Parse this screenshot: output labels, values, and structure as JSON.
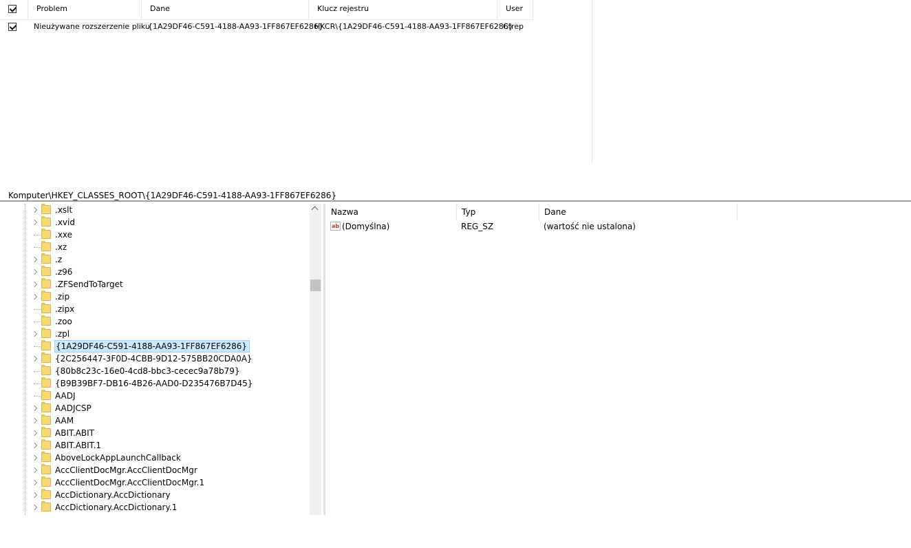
{
  "issues": {
    "columns": [
      "Problem",
      "Dane",
      "Klucz rejestru",
      "User"
    ],
    "rows": [
      {
        "checked": true,
        "problem": "Nieużywane rozszerzenie pliku",
        "data": "{1A29DF46-C591-4188-AA93-1FF867EF6286}",
        "key": "HKCR\\{1A29DF46-C591-4188-AA93-1FF867EF6286}",
        "user": "Ctrep"
      }
    ]
  },
  "address": "Komputer\\HKEY_CLASSES_ROOT\\{1A29DF46-C591-4188-AA93-1FF867EF6286}",
  "tree": {
    "items": [
      {
        "label": ".xslt",
        "expandable": true
      },
      {
        "label": ".xvid",
        "expandable": true
      },
      {
        "label": ".xxe",
        "expandable": false
      },
      {
        "label": ".xz",
        "expandable": false
      },
      {
        "label": ".z",
        "expandable": true
      },
      {
        "label": ".z96",
        "expandable": true
      },
      {
        "label": ".ZFSendToTarget",
        "expandable": true
      },
      {
        "label": ".zip",
        "expandable": true
      },
      {
        "label": ".zipx",
        "expandable": false
      },
      {
        "label": ".zoo",
        "expandable": false
      },
      {
        "label": ".zpl",
        "expandable": true
      },
      {
        "label": "{1A29DF46-C591-4188-AA93-1FF867EF6286}",
        "expandable": false,
        "selected": true
      },
      {
        "label": "{2C256447-3F0D-4CBB-9D12-575BB20CDA0A}",
        "expandable": true
      },
      {
        "label": "{80b8c23c-16e0-4cd8-bbc3-cecec9a78b79}",
        "expandable": false
      },
      {
        "label": "{B9B39BF7-DB16-4B26-AAD0-D235476B7D45}",
        "expandable": false
      },
      {
        "label": "AADJ",
        "expandable": false
      },
      {
        "label": "AADJCSP",
        "expandable": true
      },
      {
        "label": "AAM",
        "expandable": true
      },
      {
        "label": "ABIT.ABIT",
        "expandable": true
      },
      {
        "label": "ABIT.ABIT.1",
        "expandable": true
      },
      {
        "label": "AboveLockAppLaunchCallback",
        "expandable": true
      },
      {
        "label": "AccClientDocMgr.AccClientDocMgr",
        "expandable": true
      },
      {
        "label": "AccClientDocMgr.AccClientDocMgr.1",
        "expandable": true
      },
      {
        "label": "AccDictionary.AccDictionary",
        "expandable": true
      },
      {
        "label": "AccDictionary.AccDictionary.1",
        "expandable": true
      }
    ]
  },
  "values": {
    "columns": [
      "Nazwa",
      "Typ",
      "Dane"
    ],
    "rows": [
      {
        "icon": "string-value-icon",
        "icon_text": "ab",
        "name": "(Domyślna)",
        "type": "REG_SZ",
        "data": "(wartość nie ustalona)"
      }
    ]
  }
}
